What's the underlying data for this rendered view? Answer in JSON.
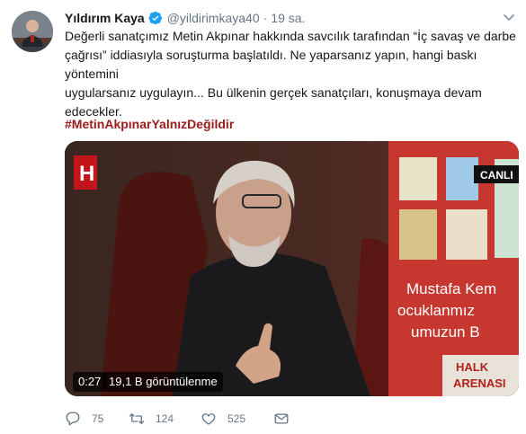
{
  "tweet": {
    "author_name": "Yıldırım Kaya",
    "handle": "@yildirimkaya40",
    "separator": "·",
    "time": "19 sa.",
    "text_lines": [
      "Değerli sanatçımız Metin Akpınar hakkında savcılık tarafından “İç savaş ve darbe",
      "çağrısı” iddiasıyla soruşturma başlatıldı. Ne yaparsanız yapın, hangi baskı yöntemini",
      "uygularsanız uygulayın... Bu ülkenin gerçek sanatçıları, konuşmaya devam",
      "edecekler."
    ],
    "hashtag": "#MetinAkpınarYalnızDeğildir"
  },
  "media": {
    "duration": "0:27",
    "views": "19,1 B görüntülenme",
    "channel_logo": "H",
    "live_badge": "CANLI",
    "banner_text": [
      "Mustafa Kem",
      "ocuklanmız",
      "umuzun B"
    ],
    "program_name": [
      "HALK",
      "ARENASI"
    ]
  },
  "actions": {
    "reply_count": "75",
    "retweet_count": "124",
    "like_count": "525"
  },
  "colors": {
    "hashtag": "#9b1a1a",
    "secondary_text": "#657786",
    "verified": "#1da1f2"
  },
  "icons": [
    "verified-icon",
    "caret-down-icon",
    "reply-icon",
    "retweet-icon",
    "like-icon",
    "message-icon"
  ]
}
